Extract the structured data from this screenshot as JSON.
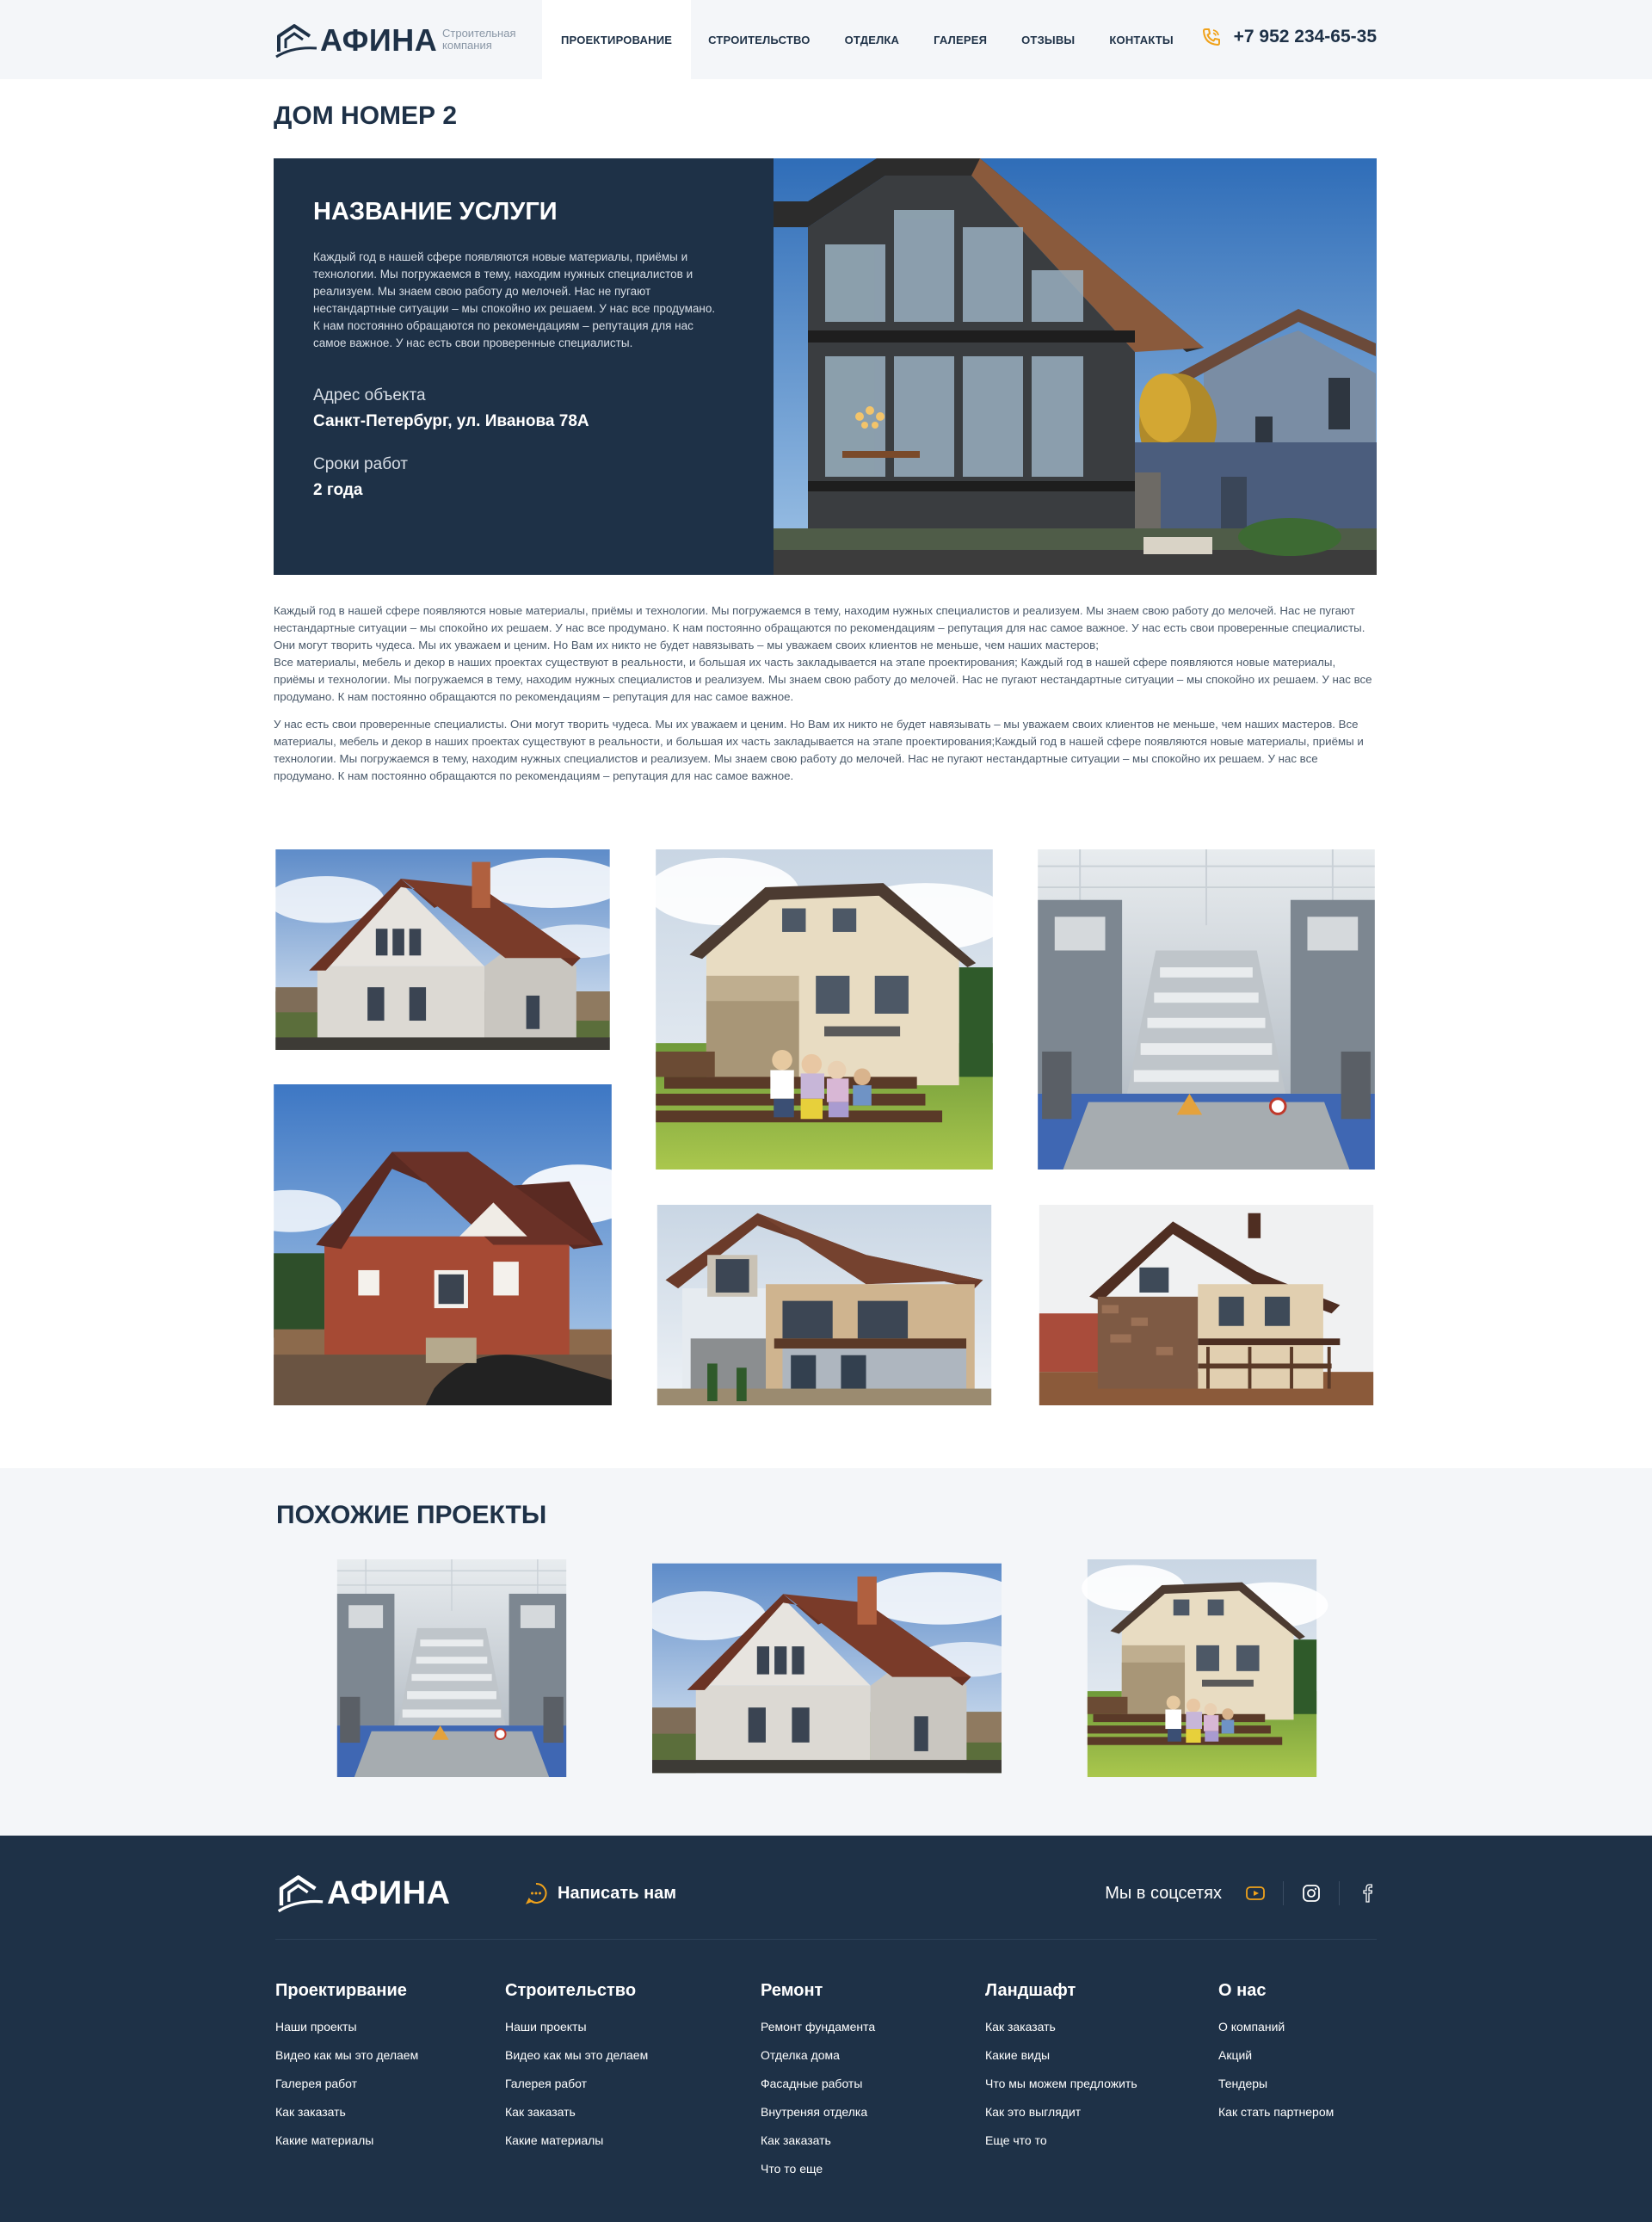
{
  "header": {
    "logo_text": "АФИНА",
    "logo_sub": "Строительная компания",
    "nav": [
      "ПРОЕКТИРОВАНИЕ",
      "СТРОИТЕЛЬСТВО",
      "ОТДЕЛКА",
      "ГАЛЕРЕЯ",
      "ОТЗЫВЫ",
      "КОНТАКТЫ"
    ],
    "phone": "+7 952 234-65-35",
    "accent": "#f0a21b"
  },
  "page_title": "ДОМ НОМЕР 2",
  "hero": {
    "title": "НАЗВАНИЕ УСЛУГИ",
    "description": "Каждый год в нашей сфере появляются новые материалы, приёмы и технологии. Мы погружаемся в тему, находим нужных специалистов и реализуем. Мы знаем свою работу до мелочей. Нас не пугают нестандартные ситуации – мы спокойно их решаем. У нас все продумано. К нам постоянно обращаются по рекомендациям – репутация для нас самое важное. У нас есть свои проверенные специалисты.",
    "address_label": "Адрес объекта",
    "address_value": "Санкт-Петербург, ул. Иванова 78А",
    "term_label": "Сроки работ",
    "term_value": "2 года"
  },
  "body": {
    "p1": "Каждый год в нашей сфере появляются новые материалы, приёмы и технологии. Мы погружаемся в тему, находим нужных специалистов и реализуем. Мы знаем свою работу до мелочей. Нас не пугают нестандартные ситуации – мы спокойно их решаем. У нас все продумано. К нам постоянно обращаются по рекомендациям – репутация для нас самое важное. У нас есть свои проверенные специалисты. Они могут творить чудеса. Мы их уважаем и ценим. Но Вам их никто не будет навязывать – мы уважаем своих клиентов не меньше, чем наших мастеров;\nВсе материалы, мебель и декор в наших проектах существуют в реальности, и большая их часть закладывается на этапе проектирования; Каждый год в нашей сфере появляются новые материалы, приёмы и технологии. Мы погружаемся в тему, находим нужных специалистов и реализуем. Мы знаем свою работу до мелочей. Нас не пугают нестандартные ситуации – мы спокойно их решаем. У нас все продумано. К нам постоянно обращаются по рекомендациям – репутация для нас самое важное.",
    "p2": "У нас есть свои проверенные специалисты. Они могут творить чудеса. Мы их уважаем и ценим. Но Вам их никто не будет навязывать – мы уважаем своих клиентов не меньше, чем наших мастеров. Все материалы, мебель и декор в наших проектах существуют в реальности, и большая их часть закладывается на этапе проектирования;Каждый год в нашей сфере появляются новые материалы, приёмы и технологии. Мы погружаемся в тему, находим нужных специалистов и реализуем. Мы знаем свою работу до мелочей. Нас не пугают нестандартные ситуации – мы спокойно их решаем. У нас все продумано. К нам постоянно обращаются по рекомендациям – репутация для нас самое важное."
  },
  "similar": {
    "title": "ПОХОЖИЕ ПРОЕКТЫ"
  },
  "footer": {
    "logo_text": "АФИНА",
    "write_us": "Написать нам",
    "social_label": "Мы в соцсетях",
    "social_icons": [
      "youtube-icon",
      "instagram-icon",
      "facebook-icon"
    ],
    "columns": [
      {
        "title": "Проектирвание",
        "links": [
          "Наши проекты",
          "Видео как мы это делаем",
          "Галерея работ",
          "Как заказать",
          "Какие материалы"
        ]
      },
      {
        "title": "Строительство",
        "links": [
          "Наши проекты",
          "Видео как мы это делаем",
          "Галерея работ",
          "Как заказать",
          "Какие материалы"
        ]
      },
      {
        "title": "Ремонт",
        "links": [
          "Ремонт фундамента",
          "Отделка дома",
          "Фасадные работы",
          "Внутреняя отделка",
          "Как заказать",
          "Что то еще"
        ]
      },
      {
        "title": "Ландшафт",
        "links": [
          "Как заказать",
          "Какие виды",
          "Что мы можем предложить",
          "Как это выглядит",
          "Еще что то"
        ]
      },
      {
        "title": "О нас",
        "links": [
          "О компаний",
          "Акций",
          "Тендеры",
          "Как стать партнером"
        ]
      }
    ]
  }
}
